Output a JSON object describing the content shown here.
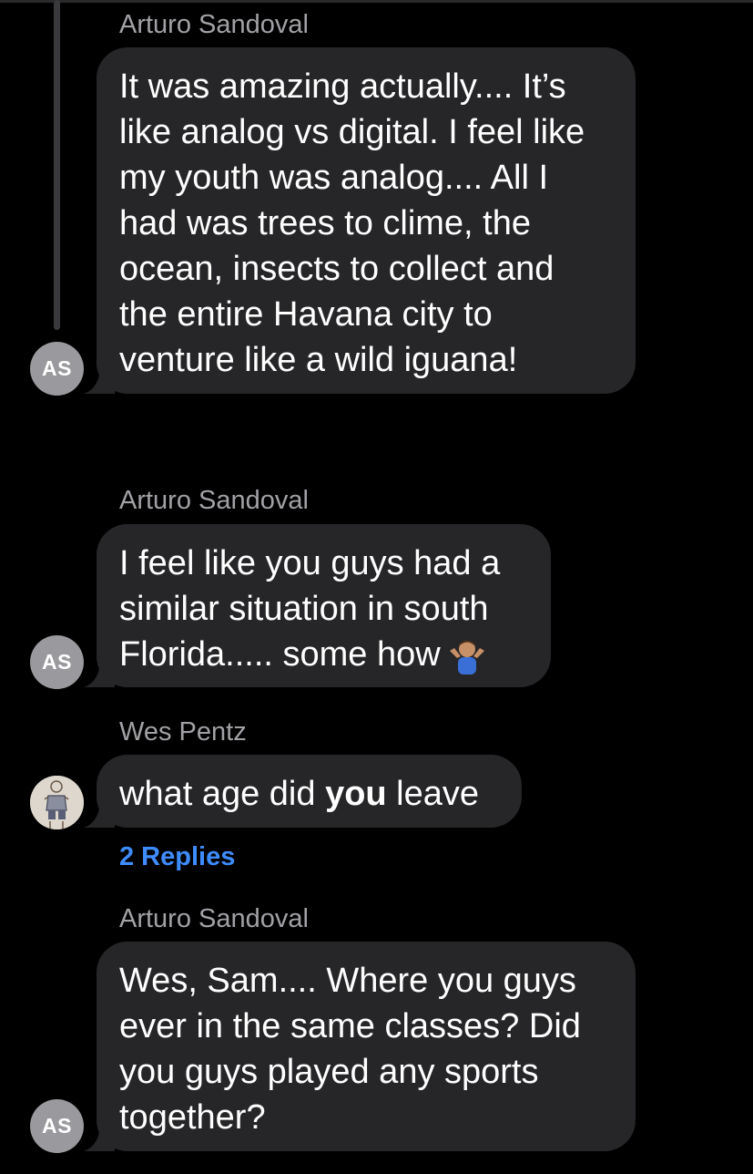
{
  "messages": [
    {
      "sender": "Arturo Sandoval",
      "avatar_initials": "AS",
      "lines": [
        "It was amazing actually.... It’s",
        "like analog vs digital. I feel like",
        "my youth was analog.... All I",
        "had was trees to clime, the",
        "ocean, insects to collect and",
        "the entire Havana city to",
        "venture like a wild iguana!"
      ]
    },
    {
      "sender": "Arturo Sandoval",
      "avatar_initials": "AS",
      "lines": [
        "I feel like you guys had a",
        "similar situation in south",
        "Florida..... some how"
      ],
      "emoji": "person-shrugging-emoji"
    },
    {
      "sender": "Wes Pentz",
      "avatar": "sketch-figure-avatar",
      "text_before": "what age did ",
      "text_bold": "you",
      "text_after": " leave",
      "replies": "2 Replies"
    },
    {
      "sender": "Arturo Sandoval",
      "avatar_initials": "AS",
      "lines": [
        "Wes, Sam.... Where you guys",
        "ever in the same classes? Did",
        "you guys played any sports",
        "together?"
      ]
    }
  ],
  "colors": {
    "background": "#000000",
    "bubble": "#262628",
    "sender_name": "#a1a1a6",
    "link": "#3f8cff",
    "avatar": "#9a9a9e"
  }
}
